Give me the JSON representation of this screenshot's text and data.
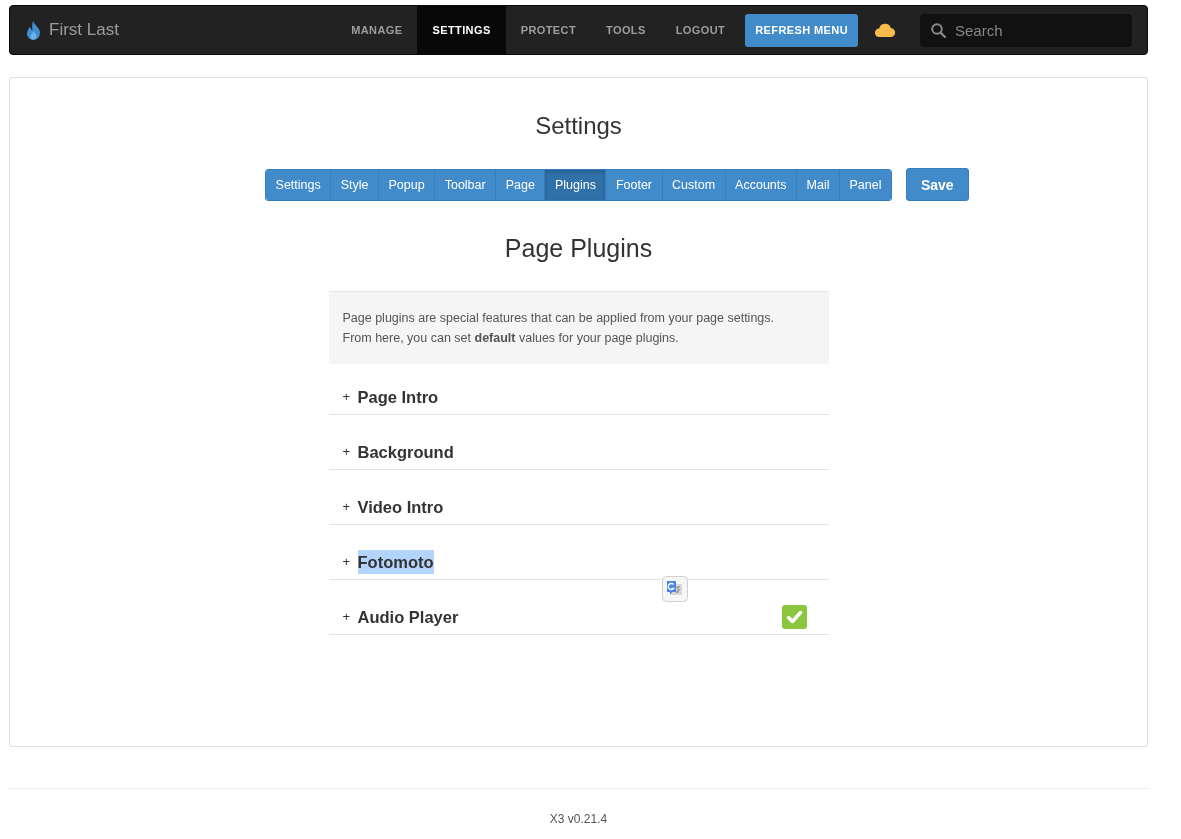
{
  "navbar": {
    "brand": "First Last",
    "menu": [
      {
        "label": "MANAGE",
        "selected": false
      },
      {
        "label": "SETTINGS",
        "selected": true
      },
      {
        "label": "PROTECT",
        "selected": false
      },
      {
        "label": "TOOLS",
        "selected": false
      },
      {
        "label": "LOGOUT",
        "selected": false
      }
    ],
    "refresh_button": "REFRESH MENU",
    "search": {
      "placeholder": "Search"
    }
  },
  "panel": {
    "title": "Settings",
    "tabs": [
      {
        "label": "Settings",
        "selected": false
      },
      {
        "label": "Style",
        "selected": false
      },
      {
        "label": "Popup",
        "selected": false
      },
      {
        "label": "Toolbar",
        "selected": false
      },
      {
        "label": "Page",
        "selected": false
      },
      {
        "label": "Plugins",
        "selected": true
      },
      {
        "label": "Footer",
        "selected": false
      },
      {
        "label": "Custom",
        "selected": false
      },
      {
        "label": "Accounts",
        "selected": false
      },
      {
        "label": "Mail",
        "selected": false
      },
      {
        "label": "Panel",
        "selected": false
      }
    ],
    "save_button": "Save",
    "section_title": "Page Plugins",
    "intro": "Page plugins are special features that can be applied from your page settings.\nFrom here, you can set **default** values for your page plugins.",
    "plugins": [
      {
        "expander": "+",
        "title": "Page Intro",
        "highlighted": false,
        "checked": false
      },
      {
        "expander": "+",
        "title": "Background",
        "highlighted": false,
        "checked": false
      },
      {
        "expander": "+",
        "title": "Video Intro",
        "highlighted": false,
        "checked": false
      },
      {
        "expander": "+",
        "title": "Fotomoto",
        "highlighted": true,
        "checked": false
      },
      {
        "expander": "+",
        "title": "Audio Player",
        "highlighted": false,
        "checked": true
      }
    ]
  },
  "footer": {
    "version": "X3 v0.21.4"
  }
}
